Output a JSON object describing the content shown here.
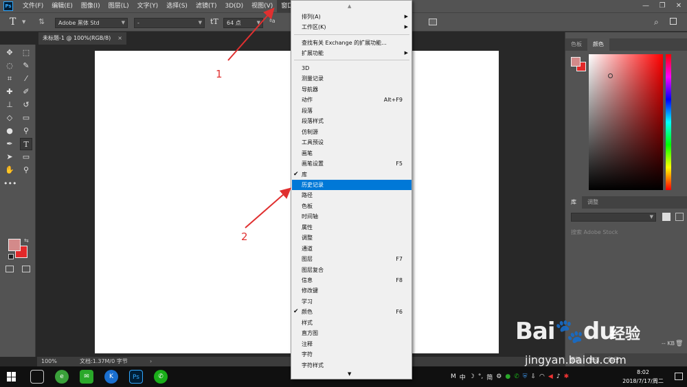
{
  "menubar": {
    "logo": "Ps",
    "items": [
      "文件(F)",
      "编辑(E)",
      "图像(I)",
      "图层(L)",
      "文字(Y)",
      "选择(S)",
      "滤镜(T)",
      "3D(D)",
      "视图(V)",
      "窗口(W)"
    ],
    "window_controls": [
      "—",
      "❐",
      "✕"
    ]
  },
  "options": {
    "font_family": "Adobe 黑体 Std",
    "font_style": "-",
    "font_size": "64 点",
    "aa_label": "ªa"
  },
  "document": {
    "tab_title": "未标题-1 @ 100%(RGB/8)",
    "close": "×",
    "zoom": "100%",
    "doc_info": "文档:1.37M/0 字节",
    "status_arrow": "›"
  },
  "panels": {
    "color_tabs": [
      "色板",
      "颜色"
    ],
    "library_tabs": [
      "库",
      "调整"
    ],
    "library_search_placeholder": "搜索 Adobe Stock",
    "kb_label": "-- KB",
    "bottom_tabs": [
      "图层",
      "通道",
      "路径"
    ],
    "colors": {
      "foreground": "#d38a8a",
      "background": "#e2292a"
    }
  },
  "window_menu": {
    "groups": [
      [
        {
          "label": "排列(A)",
          "submenu": true
        },
        {
          "label": "工作区(K)",
          "submenu": true
        }
      ],
      [
        {
          "label": "查找有关 Exchange 的扩展功能..."
        },
        {
          "label": "扩展功能",
          "submenu": true
        }
      ],
      [
        {
          "label": "3D"
        },
        {
          "label": "测量记录"
        },
        {
          "label": "导航器"
        },
        {
          "label": "动作",
          "shortcut": "Alt+F9"
        },
        {
          "label": "段落"
        },
        {
          "label": "段落样式"
        },
        {
          "label": "仿制源"
        },
        {
          "label": "工具预设"
        },
        {
          "label": "画笔"
        },
        {
          "label": "画笔设置",
          "shortcut": "F5"
        },
        {
          "label": "库",
          "checked": true
        },
        {
          "label": "历史记录",
          "highlighted": true
        },
        {
          "label": "路径"
        },
        {
          "label": "色板"
        },
        {
          "label": "时间轴"
        },
        {
          "label": "属性"
        },
        {
          "label": "调整"
        },
        {
          "label": "通道"
        },
        {
          "label": "图层",
          "shortcut": "F7"
        },
        {
          "label": "图层复合"
        },
        {
          "label": "信息",
          "shortcut": "F8"
        },
        {
          "label": "修改键"
        },
        {
          "label": "学习"
        },
        {
          "label": "颜色",
          "checked": true,
          "shortcut": "F6"
        },
        {
          "label": "样式"
        },
        {
          "label": "直方图"
        },
        {
          "label": "注释"
        },
        {
          "label": "字符"
        },
        {
          "label": "字符样式"
        }
      ]
    ],
    "scroll_up": "▲",
    "scroll_down": "▼"
  },
  "annotations": {
    "label_1": "1",
    "label_2": "2",
    "color": "#e03030"
  },
  "watermark": {
    "brand": "Bai",
    "brand2": "du",
    "cn": "经验",
    "url": "jingyan.baidu.com"
  },
  "taskbar": {
    "tray": [
      "M",
      "中",
      "☽",
      "°,",
      "简",
      "⚙"
    ],
    "time": "8:02",
    "date": "2018/7/17/周二"
  }
}
